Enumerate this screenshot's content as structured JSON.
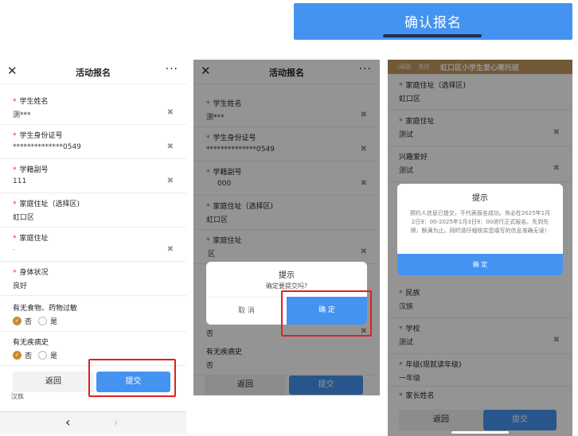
{
  "banner": {
    "title": "确认报名"
  },
  "s1": {
    "title": "活动报名",
    "fields": [
      {
        "label": "学生姓名",
        "value": "测***",
        "star": true,
        "clear": true
      },
      {
        "label": "学生身份证号",
        "value": "**************0549",
        "star": true,
        "clear": true
      },
      {
        "label": "学籍副号",
        "value": "111",
        "star": true,
        "clear": true
      },
      {
        "label": "家庭住址（选择区)",
        "value": "虹口区",
        "star": true,
        "clear": false
      },
      {
        "label": "家庭住址",
        "value": "-",
        "star": true,
        "clear": true
      },
      {
        "label": "身体状况",
        "value": "良好",
        "star": true,
        "clear": false
      }
    ],
    "allergy": {
      "label": "有无食物、药物过敏",
      "no": "否",
      "yes": "是"
    },
    "disease": {
      "label": "有无疾病史",
      "no": "否",
      "yes": "是"
    },
    "peek": "汉族",
    "back": "返回",
    "submit": "提交",
    "nav_back": "‹",
    "nav_fwd": "›"
  },
  "s2": {
    "title": "活动报名",
    "fields": [
      {
        "label": "学生姓名",
        "value": "测***"
      },
      {
        "label": "学生身份证号",
        "value": "**************0549"
      },
      {
        "label": "学籍副号",
        "value": "000"
      },
      {
        "label": "家庭住址（选择区)",
        "value": "虹口区"
      },
      {
        "label": "家庭住址",
        "value": "区"
      }
    ],
    "dialog": {
      "title": "提示",
      "msg": "确定要提交吗?",
      "cancel": "取 消",
      "confirm": "确 定"
    },
    "behind_value": "否",
    "disease": {
      "label": "有无疾病史",
      "value": "否"
    },
    "back": "返回",
    "submit": "提交"
  },
  "s3": {
    "top": {
      "back": "〈返回",
      "close": "关闭",
      "title": "虹口区小学生爱心寒托班"
    },
    "fields": [
      {
        "label": "家庭住址（选择区)",
        "value": "虹口区",
        "star": true
      },
      {
        "label": "家庭住址",
        "value": "测试",
        "star": true
      },
      {
        "label": "兴趣爱好",
        "value": "测试",
        "star": false
      }
    ],
    "dialog": {
      "title": "提示",
      "msg": "预约人信息已提交，不代表报名成功。务必在2025年1月2日9：00-2025年1月3日9：00进行正式报名。先到先得，额满为止。同时请仔细核实您填写的信息准确无误！",
      "confirm": "确 定"
    },
    "fields2": [
      {
        "label": "民族",
        "value": "汉族"
      },
      {
        "label": "学校",
        "value": "测试"
      },
      {
        "label": "年级(现就读年级)",
        "value": "一年级"
      },
      {
        "label": "家长姓名",
        "value": ""
      }
    ],
    "back": "返回",
    "submit": "提交"
  }
}
